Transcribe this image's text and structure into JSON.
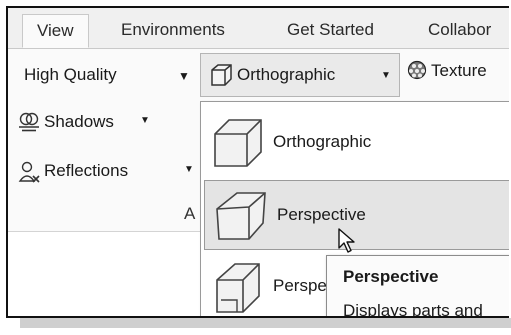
{
  "ribbon": {
    "tabs": [
      {
        "label": "View",
        "active": true
      },
      {
        "label": "Environments"
      },
      {
        "label": "Get Started"
      },
      {
        "label": "Collabor"
      }
    ]
  },
  "toolbar": {
    "quality_select": "High Quality",
    "camera_button": "Orthographic",
    "texture_button": "Texture"
  },
  "panel": {
    "shadows": "Shadows",
    "reflections": "Reflections",
    "group_label_fragment": "A"
  },
  "camera_menu": {
    "items": [
      {
        "label": "Orthographic"
      },
      {
        "label": "Perspective",
        "hovered": true
      },
      {
        "label": "Perspe"
      }
    ]
  },
  "tooltip": {
    "title": "Perspective",
    "description": "Displays parts and"
  },
  "icons": {
    "camera": "cube-orthographic-icon",
    "texture": "texture-sphere-icon",
    "shadows": "shadows-icon",
    "reflections": "reflections-icon",
    "cursor": "mouse-pointer-icon"
  }
}
